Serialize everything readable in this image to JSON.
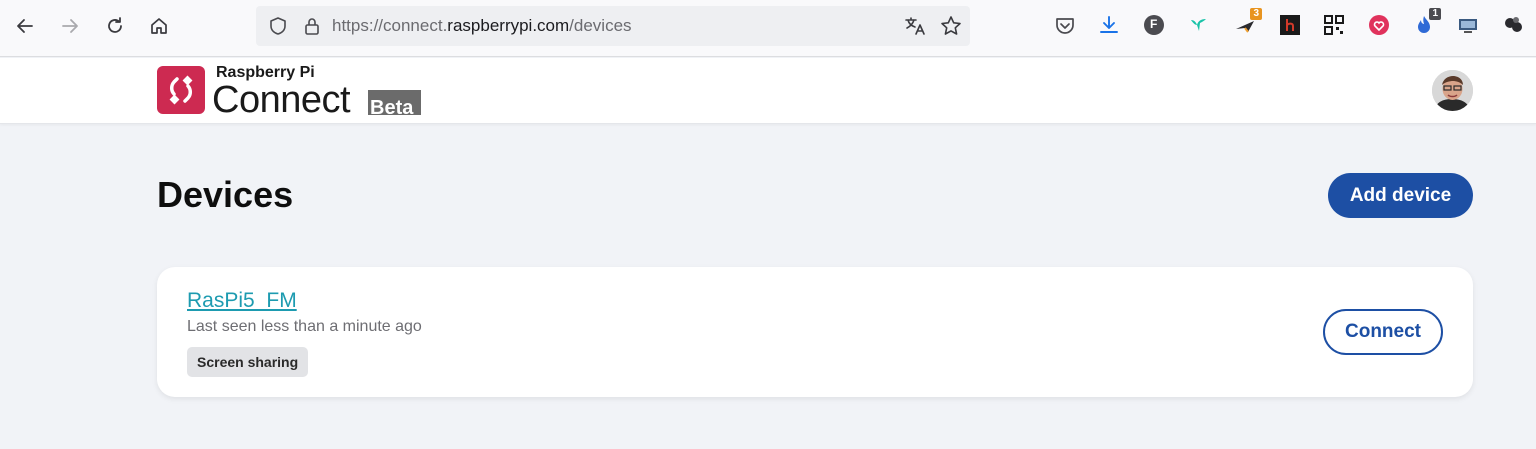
{
  "browser": {
    "url_prefix": "https://connect.",
    "url_domain": "raspberrypi.com",
    "url_path": "/devices",
    "extension_badges": {
      "notification_count": "3",
      "window_count": "1"
    },
    "extension_letter": "F"
  },
  "app": {
    "logo_small": "Raspberry Pi",
    "logo_big": "Connect",
    "beta_label": "Beta"
  },
  "page": {
    "title": "Devices",
    "add_button": "Add device"
  },
  "devices": [
    {
      "name": "RasPi5_FM",
      "status": "Last seen less than a minute ago",
      "badge": "Screen sharing",
      "connect_label": "Connect"
    }
  ],
  "colors": {
    "brand_red": "#cd2a51",
    "primary_blue": "#1d4fa4",
    "link_teal": "#1d9bb0"
  }
}
